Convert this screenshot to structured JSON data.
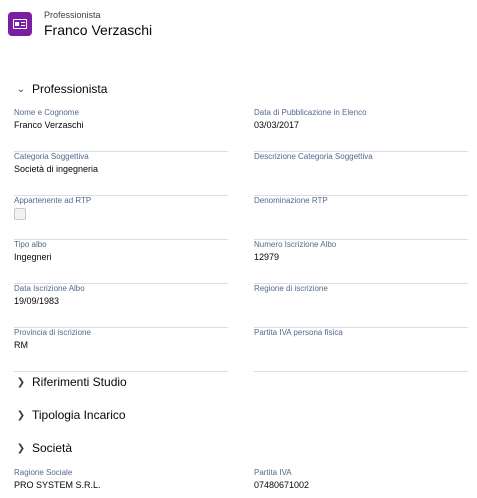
{
  "header": {
    "subtitle": "Professionista",
    "title": "Franco Verzaschi",
    "icon": "contact-card-icon",
    "icon_color": "#7b1fa2"
  },
  "sections": {
    "professionista": {
      "label": "Professionista",
      "expanded": true
    },
    "riferimenti": {
      "label": "Riferimenti Studio",
      "expanded": false
    },
    "tipologia": {
      "label": "Tipologia Incarico",
      "expanded": false
    },
    "societa": {
      "label": "Società",
      "expanded": false
    }
  },
  "fields": {
    "nome_cognome": {
      "label": "Nome e Cognome",
      "value": "Franco Verzaschi"
    },
    "data_pubblicazione": {
      "label": "Data di Pubblicazione in Elenco",
      "value": "03/03/2017"
    },
    "categoria": {
      "label": "Categoria Soggettiva",
      "value": "Società di ingegneria"
    },
    "descrizione_categoria": {
      "label": "Descrizione Categoria Soggettiva",
      "value": ""
    },
    "appartenente_rtp": {
      "label": "Appartenente ad RTP",
      "checked": false
    },
    "denominazione_rtp": {
      "label": "Denominazione RTP",
      "value": ""
    },
    "tipo_albo": {
      "label": "Tipo albo",
      "value": "Ingegneri"
    },
    "numero_iscrizione": {
      "label": "Numero Iscrizione Albo",
      "value": "12979"
    },
    "data_iscrizione": {
      "label": "Data Iscrizione Albo",
      "value": "19/09/1983"
    },
    "regione_iscrizione": {
      "label": "Regione di iscrizione",
      "value": ""
    },
    "provincia_iscrizione": {
      "label": "Provincia di iscrizione",
      "value": "RM"
    },
    "partita_iva_pf": {
      "label": "Partita IVA persona fisica",
      "value": ""
    },
    "ragione_sociale": {
      "label": "Ragione Sociale",
      "value": "PRO SYSTEM S.R.L."
    },
    "partita_iva": {
      "label": "Partita IVA",
      "value": "07480671002"
    }
  }
}
